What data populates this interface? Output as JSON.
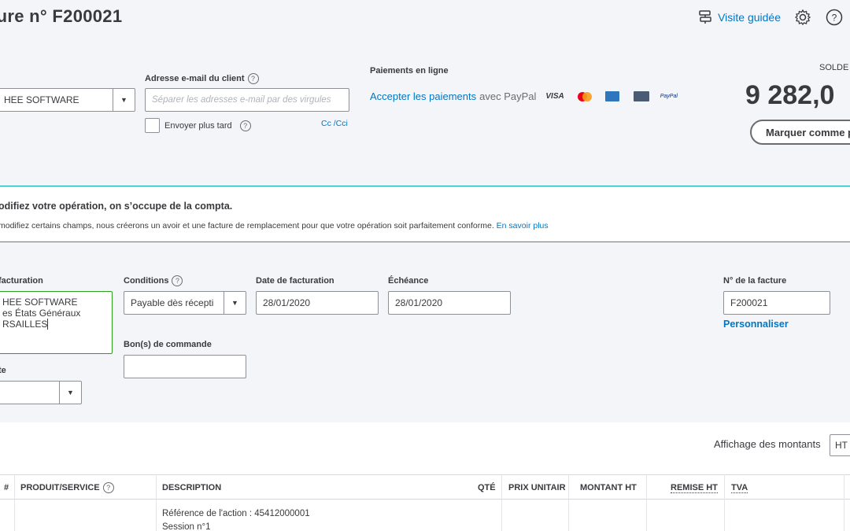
{
  "header": {
    "title": "ture n° F200021",
    "tour_label": "Visite guidée"
  },
  "customer": {
    "selected": "HEE SOFTWARE"
  },
  "email": {
    "label": "Adresse e-mail du client",
    "placeholder": "Séparer les adresses e-mail par des virgules",
    "send_later_label": "Envoyer plus tard",
    "cc_label": "Cc /Cci"
  },
  "online_payments": {
    "title": "Paiements en ligne",
    "accept_link": "Accepter les paiements",
    "with_paypal": "avec PayPal",
    "cards": [
      "VISA",
      "mastercard",
      "amex",
      "cb",
      "PayPal"
    ]
  },
  "balance": {
    "label": "SOLDE",
    "amount": "9 282,0",
    "mark_button": "Marquer comme p"
  },
  "notice": {
    "title": "odifiez votre opération, on s’occupe de la compta.",
    "body": "modifiez certains champs, nous créerons un avoir et une facture de remplacement pour que votre opération soit parfaitement conforme.",
    "learn_more": "En savoir plus"
  },
  "form": {
    "billing_label": "facturation",
    "billing_lines": [
      "HEE SOFTWARE",
      "es États Généraux",
      "RSAILLES"
    ],
    "terms_label": "Conditions",
    "terms_value": "Payable dès récepti",
    "invoice_date_label": "Date de facturation",
    "invoice_date": "28/01/2020",
    "due_label": "Échéance",
    "due_date": "28/01/2020",
    "po_label": "Bon(s) de commande",
    "te_label": "te",
    "invoice_no_label": "N° de la facture",
    "invoice_no": "F200021",
    "customize_link": "Personnaliser"
  },
  "amounts_display": {
    "label": "Affichage des montants",
    "value": "HT"
  },
  "table": {
    "headers": {
      "num": "#",
      "product": "PRODUIT/SERVICE",
      "description": "DESCRIPTION",
      "qty": "QTÉ",
      "unit_price": "PRIX UNITAIR",
      "amount_ht": "MONTANT HT",
      "discount_ht": "REMISE HT",
      "tva": "TVA"
    },
    "rows": [
      {
        "description_line1": "Référence de l'action : 45412000001",
        "description_line2": "Session n°1"
      }
    ]
  },
  "colors": {
    "link": "#0077c5",
    "green": "#2ca01c",
    "teal": "#00a6a4"
  }
}
